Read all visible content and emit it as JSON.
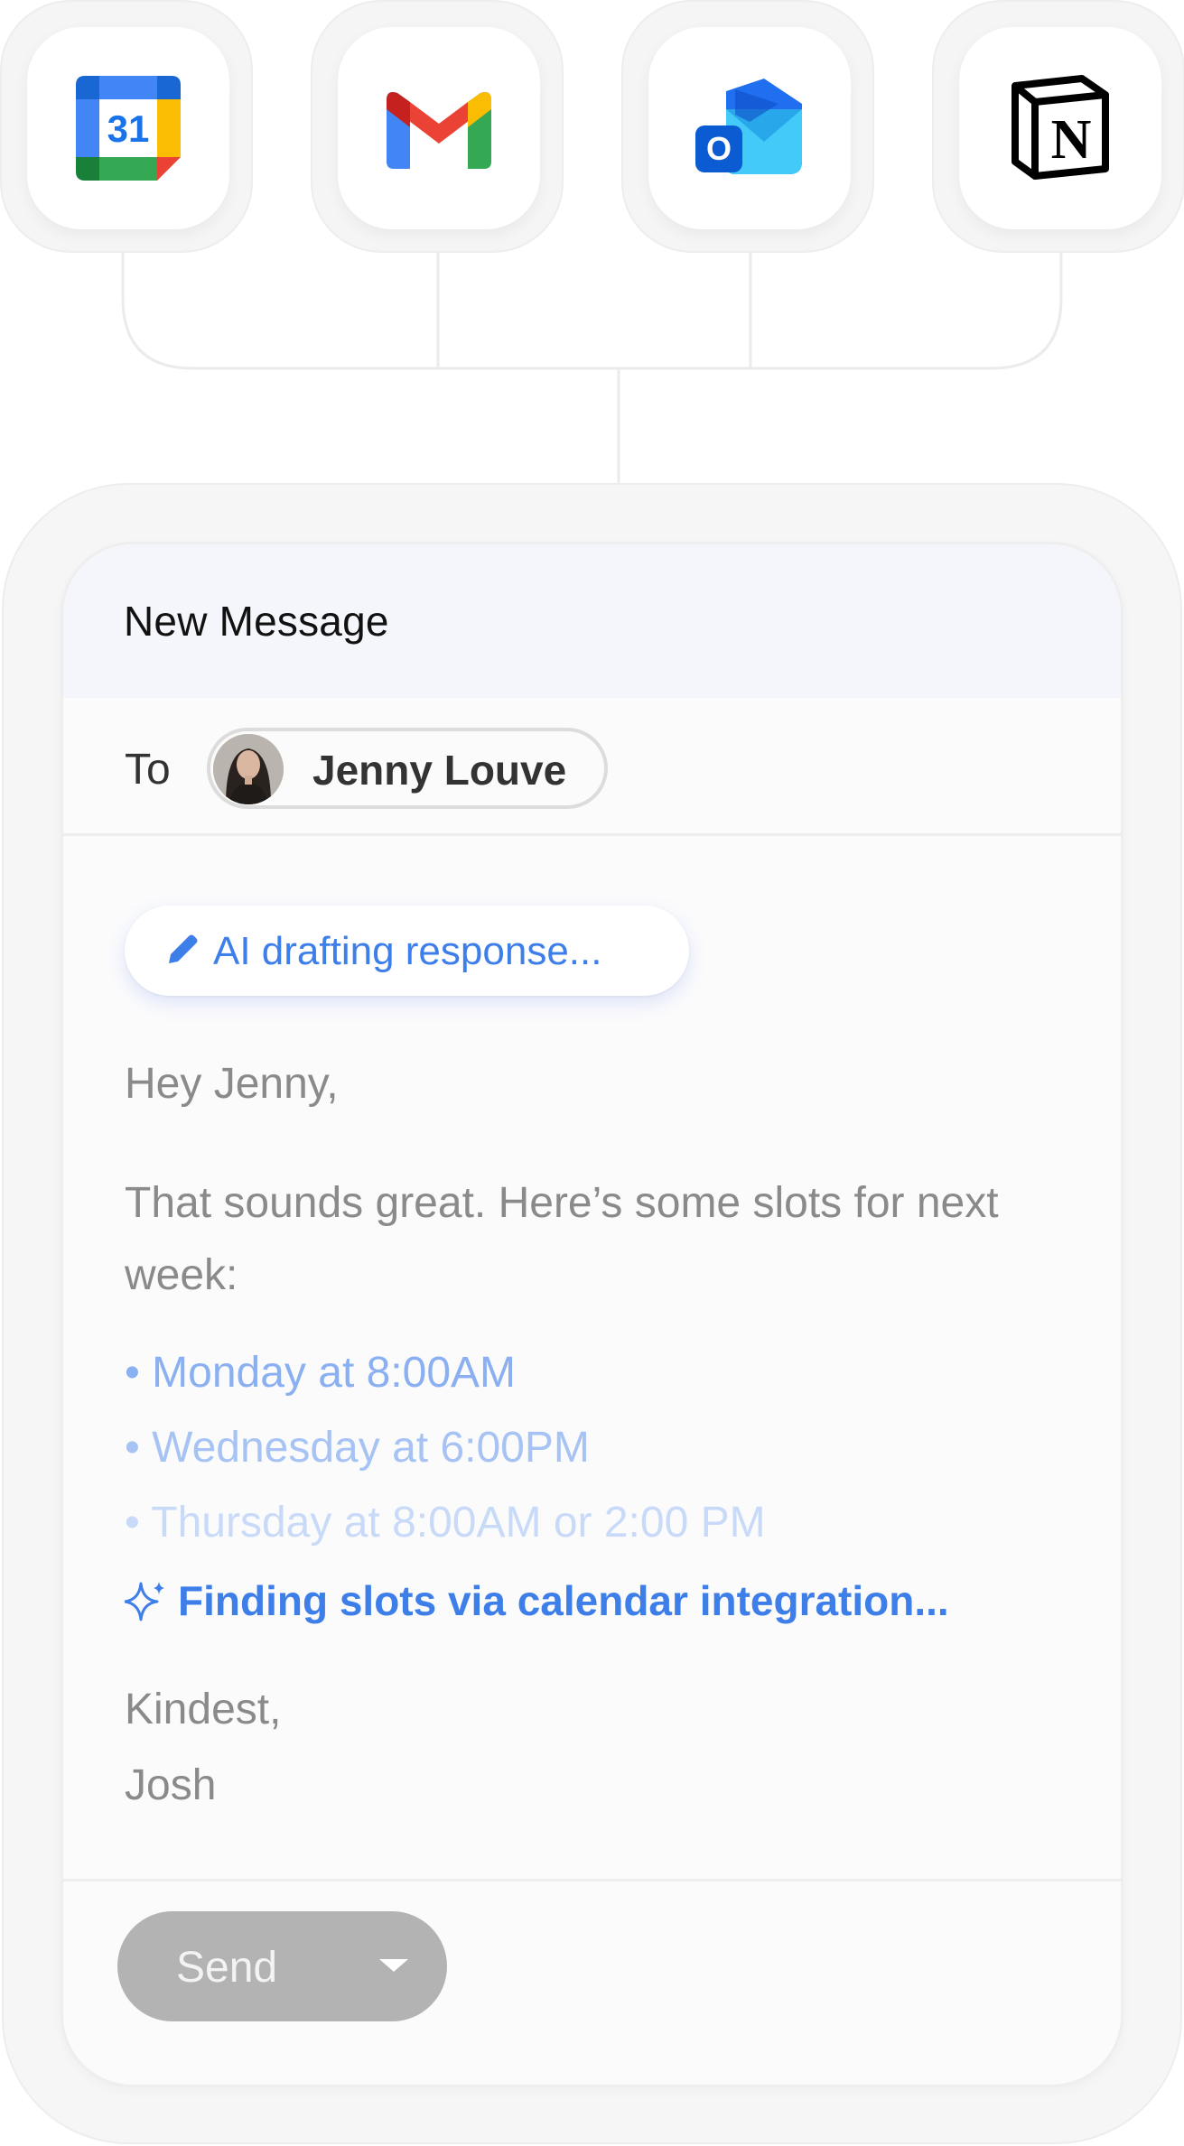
{
  "integrations": [
    {
      "name": "Google Calendar",
      "icon": "google-calendar-icon",
      "calendar_day": "31"
    },
    {
      "name": "Gmail",
      "icon": "gmail-icon"
    },
    {
      "name": "Outlook",
      "icon": "outlook-icon",
      "letter": "O"
    },
    {
      "name": "Notion",
      "icon": "notion-icon",
      "letter": "N"
    }
  ],
  "compose": {
    "title": "New Message",
    "to_label": "To",
    "recipient": {
      "name": "Jenny Louve",
      "avatar": "avatar-photo"
    },
    "ai_status": "AI drafting response...",
    "greeting": "Hey Jenny,",
    "paragraph": "That sounds great. Here’s some slots for next week:",
    "slots": [
      "• Monday at 8:00AM",
      "• Wednesday at 6:00PM",
      "• Thursday at 8:00AM or 2:00 PM"
    ],
    "finding_status": "Finding slots via calendar integration...",
    "signoff": "Kindest,",
    "signature": "Josh",
    "send_label": "Send"
  },
  "colors": {
    "accent": "#3d7ee9",
    "send_button": "#b3b3b3",
    "body_text": "#8a8a8a"
  }
}
